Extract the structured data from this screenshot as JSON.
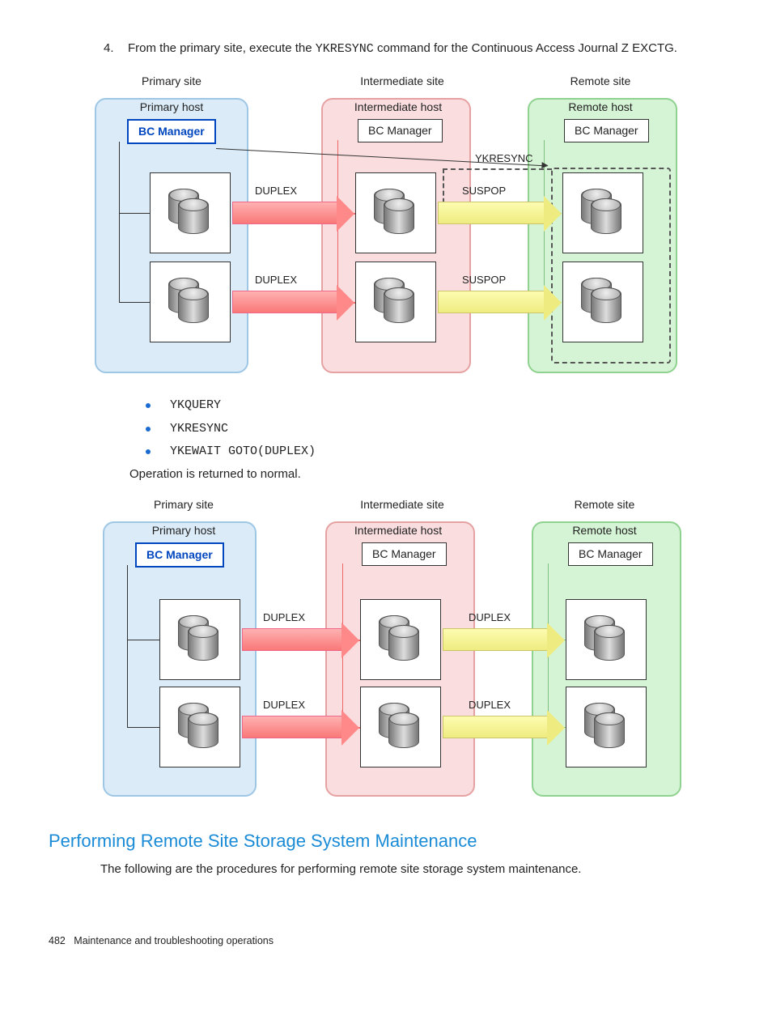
{
  "step": {
    "number": "4.",
    "pretext": "From the primary site, execute the ",
    "command": "YKRESYNC",
    "posttext": " command for the Continuous Access Journal Z EXCTG."
  },
  "labels": {
    "primary_site": "Primary site",
    "intermediate_site": "Intermediate site",
    "remote_site": "Remote site",
    "primary_host": "Primary host",
    "intermediate_host": "Intermediate host",
    "remote_host": "Remote host",
    "bc_manager": "BC Manager"
  },
  "status": {
    "duplex": "DUPLEX",
    "suspop": "SUSPOP",
    "ykresync": "YKRESYNC"
  },
  "bullets": [
    "YKQUERY",
    "YKRESYNC",
    "YKEWAIT GOTO(DUPLEX)"
  ],
  "normal_text": "Operation is returned to normal.",
  "section": {
    "heading": "Performing Remote Site Storage System Maintenance",
    "body": "The following are the procedures for performing remote site storage system maintenance."
  },
  "footer": {
    "page": "482",
    "title": "Maintenance and troubleshooting operations"
  }
}
